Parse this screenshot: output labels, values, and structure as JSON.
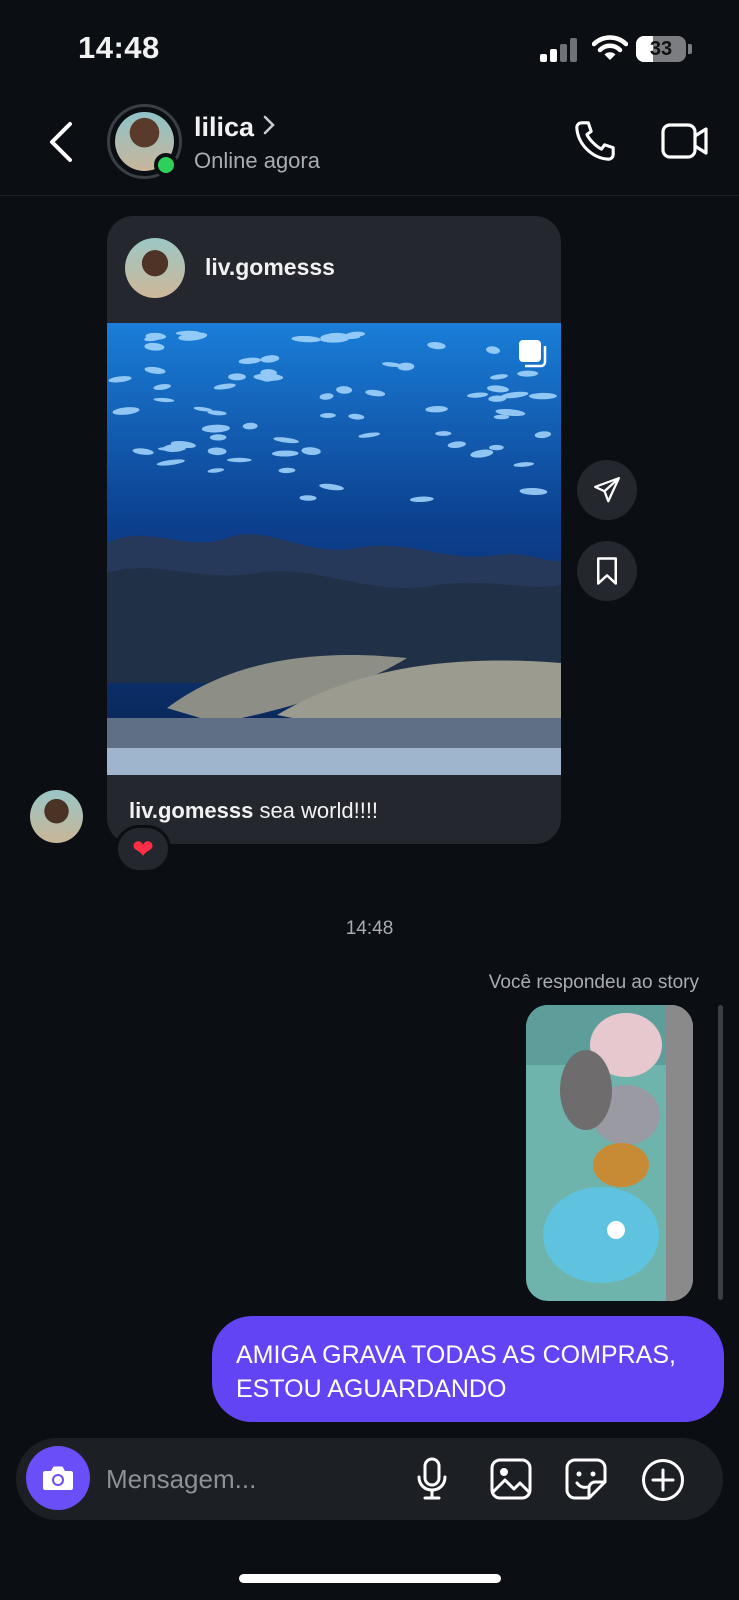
{
  "status_bar": {
    "time": "14:48",
    "battery": "33",
    "battery_level": 0.33
  },
  "header": {
    "name": "lilica",
    "subtitle": "Online agora"
  },
  "post": {
    "username": "liv.gomesss",
    "caption_user": "liv.gomesss",
    "caption_text": " sea world!!!!"
  },
  "reaction": {
    "emoji": "❤"
  },
  "timestamp": "14:48",
  "story_reply": {
    "label": "Você respondeu ao story"
  },
  "outgoing_message": {
    "lines": [
      "AMIGA GRAVA TODAS AS COMPRAS,",
      "ESTOU AGUARDANDO"
    ]
  },
  "composer": {
    "placeholder": "Mensagem..."
  },
  "colors": {
    "accent": "#6344f5",
    "camera": "#6a4ef8",
    "online": "#2fd05a",
    "background": "#0b0f14"
  },
  "icons": [
    "back-icon",
    "chevron-right-icon",
    "phone-icon",
    "video-icon",
    "multi-post-icon",
    "share-icon",
    "bookmark-icon",
    "camera-icon",
    "microphone-icon",
    "gallery-icon",
    "sticker-icon",
    "add-icon"
  ]
}
